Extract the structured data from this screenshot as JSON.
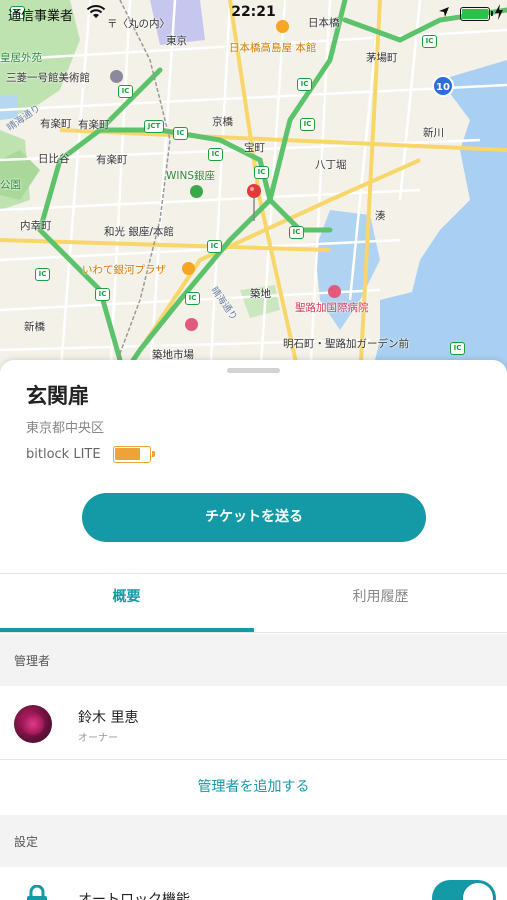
{
  "status_bar": {
    "carrier": "通信事業者",
    "time": "22:21",
    "battery_level": 1.0,
    "charging": true
  },
  "map": {
    "labels": {
      "kokyo_gaien": "皇居外苑",
      "mitsubishi_museum": "三菱一号館美術館",
      "yurakucho_1": "有楽町",
      "yurakucho_2": "有楽町",
      "hibiya": "日比谷",
      "hibiya_street": "晴海通り",
      "park": "公園",
      "uchisaiwaicho": "内幸町",
      "shinbashi": "新橋",
      "marunouchi": "〒〈丸の内〉",
      "tokyo": "東京",
      "kyobashi": "京橋",
      "takaracho": "宝町",
      "wins_ginza": "WINS銀座",
      "wako": "和光 銀座/本館",
      "iwate_plaza": "いわて銀河プラザ",
      "tsukiji": "築地",
      "tsukiji_market": "築地市場",
      "harumi_dori": "晴海通り",
      "nihonbashi": "日本橋",
      "takashimaya": "日本橋高島屋 本館",
      "kayabacho": "茅場町",
      "hatchobori": "八丁堀",
      "shinkawa": "新川",
      "minato": "湊",
      "st_lukes": "聖路加国際病院",
      "akashicho": "明石町・聖路加ガーデン前"
    },
    "ic_label": "IC",
    "jct_label": "JCT",
    "route_number": "10"
  },
  "lock": {
    "name": "玄関扉",
    "address": "東京都中央区",
    "device": "bitlock LITE",
    "battery_level": 0.75
  },
  "send_ticket_button": "チケットを送る",
  "tabs": {
    "overview": "概要",
    "history": "利用履歴",
    "active": "overview"
  },
  "admins": {
    "header": "管理者",
    "items": [
      {
        "name": "鈴木 里恵",
        "role": "オーナー"
      }
    ],
    "add_label": "管理者を追加する"
  },
  "settings": {
    "header": "設定",
    "auto_lock_label": "オートロック機能",
    "auto_lock_on": true
  },
  "colors": {
    "accent": "#149aa7",
    "battery": "#eba33a",
    "map_road_green": "#5cc26b",
    "pin": "#e23a3a"
  }
}
